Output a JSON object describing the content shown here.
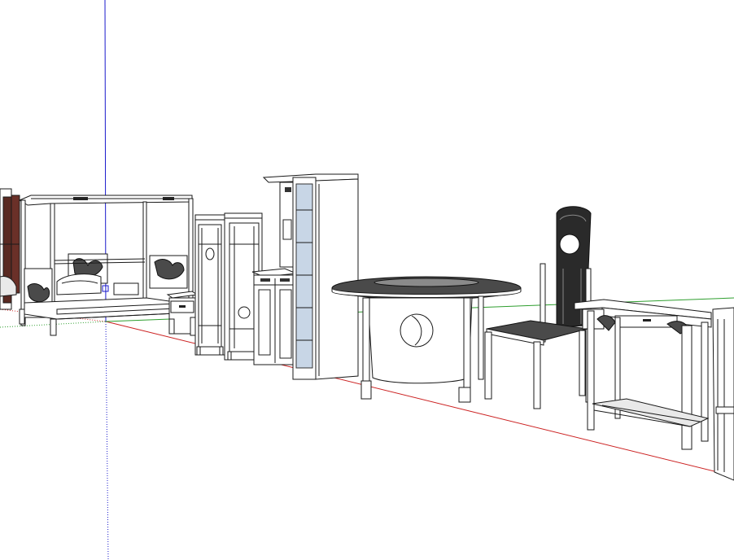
{
  "colors": {
    "background": "#ffffff",
    "axis_red": "#cc2222",
    "axis_green": "#2e9e2e",
    "axis_blue": "#1a1acc",
    "line": "#1a1a1a",
    "glass": "#c8d6e6",
    "wood_dark": "#5a2a22"
  },
  "icons": {
    "origin": "axis-origin-icon"
  }
}
